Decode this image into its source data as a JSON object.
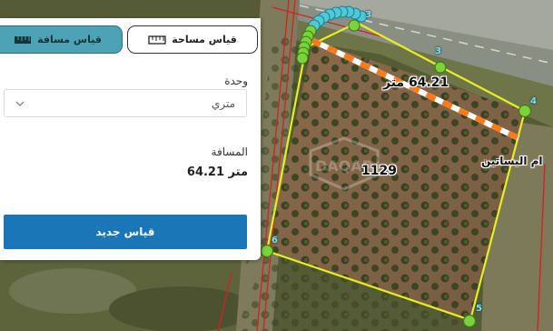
{
  "panel": {
    "tab_area_label": "قياس مساحة",
    "tab_distance_label": "قياس مسافة",
    "unit_label": "وحدة",
    "unit_selected": "متري",
    "distance_label": "المسافة",
    "distance_value": "متر 64.21",
    "new_measure_label": "قياس جديد"
  },
  "map": {
    "distance_label": "64.21 متر",
    "parcel_number": "1129",
    "place_name": "ام البساتين",
    "vertex_labels": [
      "3",
      "3",
      "4",
      "6",
      "5"
    ],
    "watermark_text": "DAQAR"
  },
  "colors": {
    "parcel_outline": "#e6f020",
    "vertex_fill": "#7bd23a",
    "measure_dash": "#ff7a1a",
    "active_tab": "#4da3b5",
    "primary_button": "#1b76b8",
    "boundary_red": "#d62020"
  },
  "icons": {
    "area_tab": "ruler-icon",
    "distance_tab": "ruler-icon",
    "unit_dropdown": "chevron-down-icon"
  }
}
